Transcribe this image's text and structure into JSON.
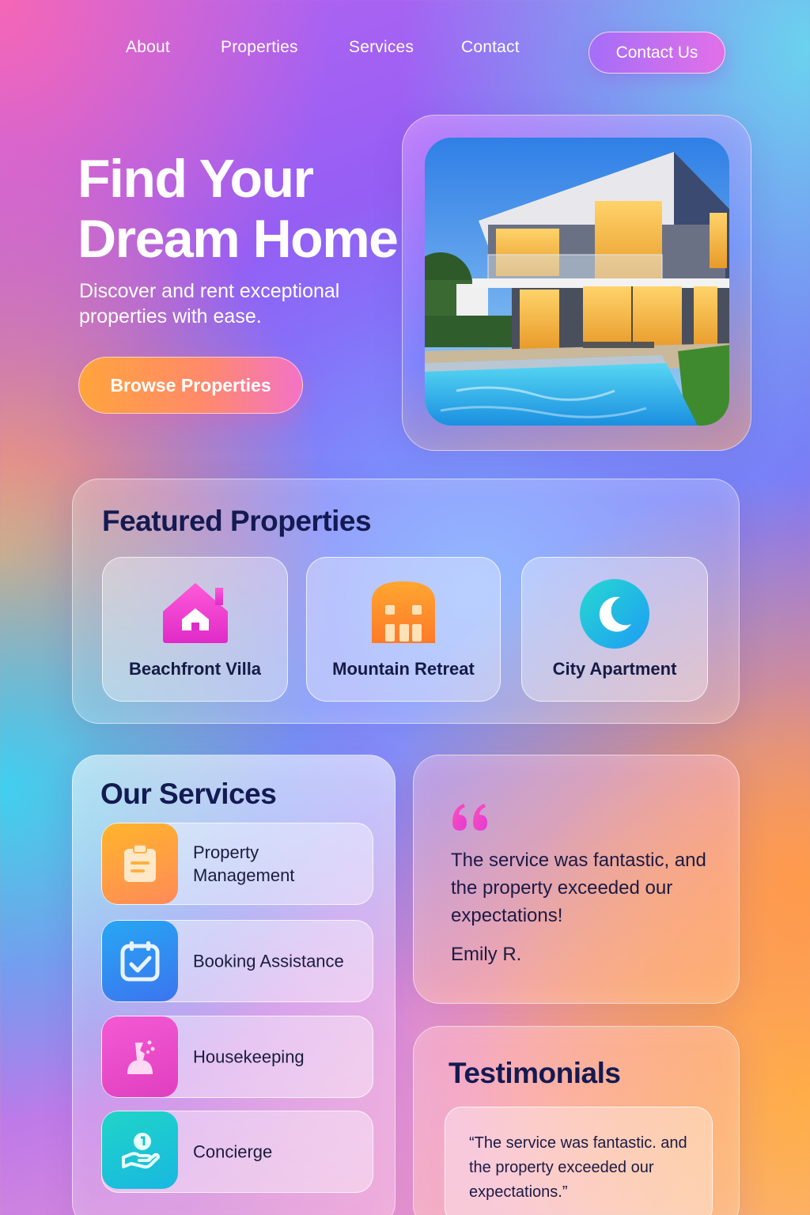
{
  "nav": {
    "links": [
      "About",
      "Properties",
      "Services",
      "Contact"
    ],
    "cta": "Contact Us"
  },
  "hero": {
    "title_line1": "Find Your",
    "title_line2": "Dream Home",
    "subtitle": "Discover and rent exceptional properties with ease.",
    "button": "Browse Properties",
    "image_icon": "modern-house-pool-image"
  },
  "featured": {
    "title": "Featured Properties",
    "cards": [
      {
        "label": "Beachfront Villa",
        "icon": "house-icon"
      },
      {
        "label": "Mountain Retreat",
        "icon": "building-icon"
      },
      {
        "label": "City Apartment",
        "icon": "moon-icon"
      }
    ]
  },
  "services": {
    "title": "Our Services",
    "items": [
      {
        "label": "Property Management",
        "icon": "clipboard-icon"
      },
      {
        "label": "Booking Assistance",
        "icon": "calendar-check-icon"
      },
      {
        "label": "Housekeeping",
        "icon": "cleaning-icon"
      },
      {
        "label": "Concierge",
        "icon": "hand-service-icon"
      }
    ]
  },
  "quote": {
    "text": "The service was fantastic, and the property exceeded our expectations!",
    "author": "Emily R."
  },
  "testimonials": {
    "title": "Testimonials",
    "text": "“The service was fantastic. and the property exceeded our expectations.”"
  },
  "colors": {
    "heading": "#141a52",
    "accent_pink": "#e24ad8",
    "accent_orange": "#ff9a3c"
  }
}
